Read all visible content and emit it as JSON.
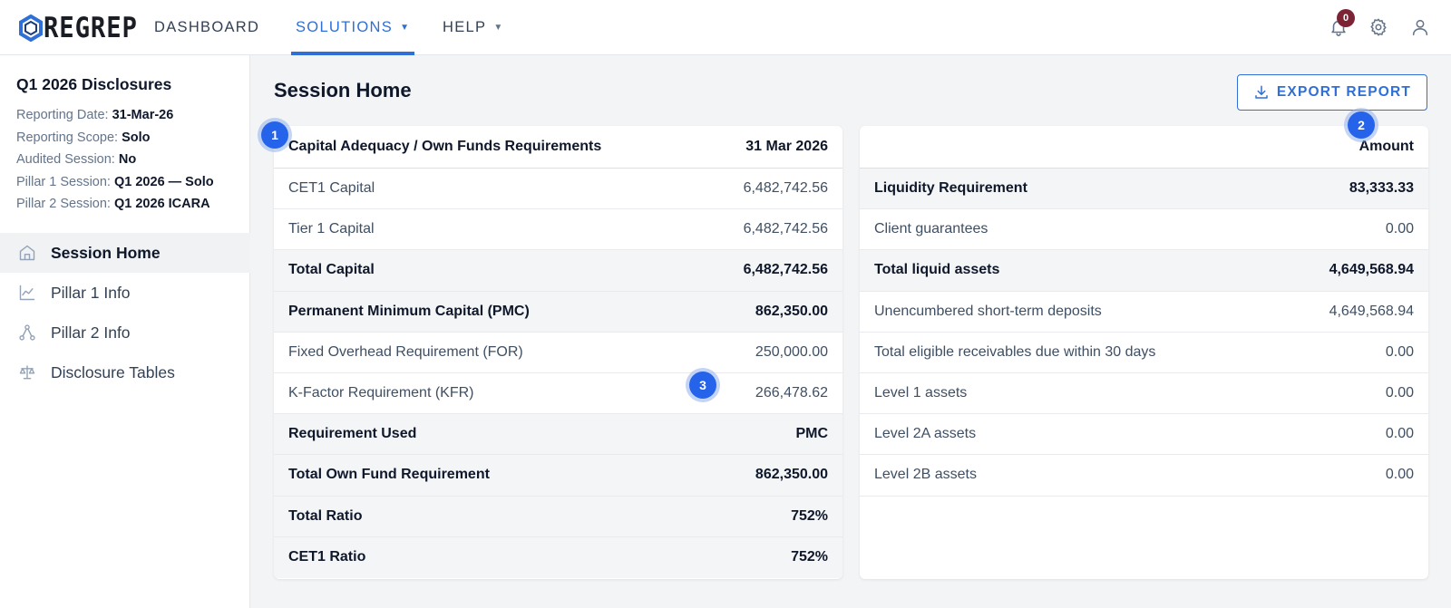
{
  "nav": {
    "logo_text": "REGREP",
    "dashboard": "DASHBOARD",
    "solutions": "SOLUTIONS",
    "help": "HELP",
    "notification_count": "0"
  },
  "sidebar": {
    "title": "Q1 2026 Disclosures",
    "meta": [
      {
        "label": "Reporting Date:",
        "value": "31-Mar-26"
      },
      {
        "label": "Reporting Scope:",
        "value": "Solo"
      },
      {
        "label": "Audited Session:",
        "value": "No"
      },
      {
        "label": "Pillar 1 Session:",
        "value": "Q1 2026 — Solo"
      },
      {
        "label": "Pillar 2 Session:",
        "value": "Q1 2026 ICARA"
      }
    ],
    "items": [
      {
        "label": "Session Home",
        "icon": "home-icon"
      },
      {
        "label": "Pillar 1 Info",
        "icon": "line-chart-icon"
      },
      {
        "label": "Pillar 2 Info",
        "icon": "nodes-icon"
      },
      {
        "label": "Disclosure Tables",
        "icon": "scale-icon"
      }
    ]
  },
  "main": {
    "title": "Session Home",
    "export_label": "EXPORT REPORT",
    "left_table": {
      "header_label": "Capital Adequacy / Own Funds Requirements",
      "header_value": "31 Mar 2026",
      "rows": [
        {
          "label": "CET1 Capital",
          "value": "6,482,742.56"
        },
        {
          "label": "Tier 1 Capital",
          "value": "6,482,742.56"
        },
        {
          "label": "Total Capital",
          "value": "6,482,742.56"
        },
        {
          "label": "Permanent Minimum Capital (PMC)",
          "value": "862,350.00"
        },
        {
          "label": "Fixed Overhead Requirement (FOR)",
          "value": "250,000.00"
        },
        {
          "label": "K-Factor Requirement (KFR)",
          "value": "266,478.62"
        },
        {
          "label": "Requirement Used",
          "value": "PMC"
        },
        {
          "label": "Total Own Fund Requirement",
          "value": "862,350.00"
        },
        {
          "label": "Total Ratio",
          "value": "752%"
        },
        {
          "label": "CET1 Ratio",
          "value": "752%"
        }
      ]
    },
    "right_table": {
      "header_label": "",
      "header_value": "Amount",
      "rows": [
        {
          "label": "Liquidity Requirement",
          "value": "83,333.33"
        },
        {
          "label": "Client guarantees",
          "value": "0.00"
        },
        {
          "label": "Total liquid assets",
          "value": "4,649,568.94"
        },
        {
          "label": "Unencumbered short-term deposits",
          "value": "4,649,568.94"
        },
        {
          "label": "Total eligible receivables due within 30 days",
          "value": "0.00"
        },
        {
          "label": "Level 1 assets",
          "value": "0.00"
        },
        {
          "label": "Level 2A assets",
          "value": "0.00"
        },
        {
          "label": "Level 2B assets",
          "value": "0.00"
        }
      ]
    }
  },
  "markers": [
    "1",
    "2",
    "3"
  ],
  "colors": {
    "accent": "#2f6fd6",
    "badge": "#7c2436",
    "marker": "#2563eb"
  }
}
